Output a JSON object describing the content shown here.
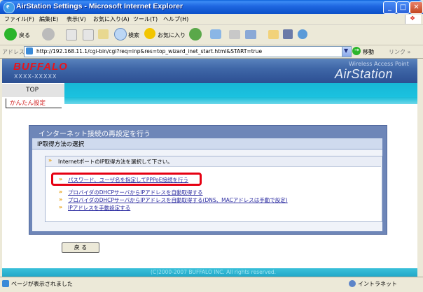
{
  "window": {
    "title": "AirStation Settings - Microsoft Internet Explorer",
    "controls": {
      "minimize": "_",
      "maximize": "□",
      "close": "✕"
    }
  },
  "menu": [
    "ファイル(F)",
    "編集(E)",
    "表示(V)",
    "お気に入り(A)",
    "ツール(T)",
    "ヘルプ(H)"
  ],
  "toolbar": {
    "back_label": "戻る",
    "search_label": "検索",
    "favorites_label": "お気に入り"
  },
  "address": {
    "label": "アドレス(D)",
    "url": "http://192.168.11.1/cgi-bin/cgi?req=inp&res=top_wizard_inet_start.html&START=true",
    "go_label": "移動",
    "links_label": "リンク »"
  },
  "page": {
    "brand": "BUFFALO",
    "model": "XXXX-XXXXX",
    "tagline": "Wireless Access Point",
    "product": "AirStation",
    "top_tab": "TOP",
    "easy_setup": "かんたん設定",
    "panel_title": "インターネット接続の再設定を行う",
    "panel_subtitle": "IP取得方法の選択",
    "instruction": "InternetポートのIP取得方法を選択して下さい。",
    "options": [
      "パスワード、ユーザ名を指定してPPPoE接続を行う",
      "プロバイダのDHCPサーバからIPアドレスを自動取得する",
      "プロバイダのDHCPサーバからIPアドレスを自動取得する(DNS、MACアドレスは手動で設定)",
      "IPアドレスを手動設定する"
    ],
    "back_button": "戻 る",
    "footer": "(C)2000-2007 BUFFALO INC. All rights reserved."
  },
  "status": {
    "text": "ページが表示されました",
    "zone": "イントラネット"
  },
  "colors": {
    "title_bar": "#0B50C8",
    "brand_red": "#e8141b",
    "highlight_box": "#e60012",
    "nav_cyan": "#1cc6e3",
    "panel_blue": "#6e86b8"
  }
}
